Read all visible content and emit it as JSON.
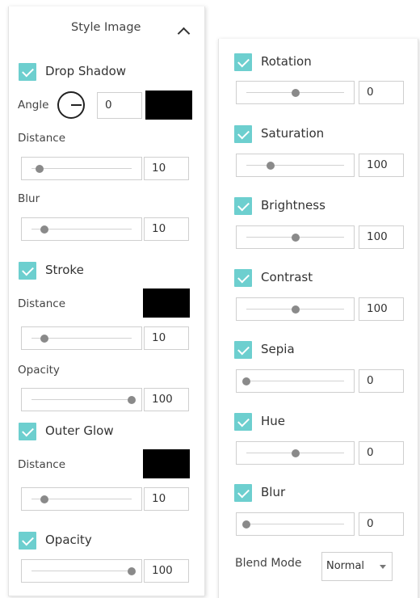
{
  "header": {
    "title": "Style Image"
  },
  "left": {
    "drop_shadow": {
      "label": "Drop Shadow",
      "checked": true,
      "angle_label": "Angle",
      "angle_value": "0",
      "color": "#000000",
      "distance_label": "Distance",
      "distance_value": "10",
      "distance_fraction": 0.08,
      "blur_label": "Blur",
      "blur_value": "10",
      "blur_fraction": 0.13
    },
    "stroke": {
      "label": "Stroke",
      "checked": true,
      "color": "#000000",
      "distance_label": "Distance",
      "distance_value": "10",
      "distance_fraction": 0.13,
      "opacity_label": "Opacity",
      "opacity_value": "100",
      "opacity_fraction": 1.0
    },
    "outer_glow": {
      "label": "Outer Glow",
      "checked": true,
      "color": "#000000",
      "distance_label": "Distance",
      "distance_value": "10",
      "distance_fraction": 0.13
    },
    "opacity": {
      "label": "Opacity",
      "checked": true,
      "value": "100",
      "fraction": 1.0
    }
  },
  "right": {
    "rotation": {
      "label": "Rotation",
      "checked": true,
      "value": "0",
      "fraction": 0.5
    },
    "saturation": {
      "label": "Saturation",
      "checked": true,
      "value": "100",
      "fraction": 0.25
    },
    "brightness": {
      "label": "Brightness",
      "checked": true,
      "value": "100",
      "fraction": 0.5
    },
    "contrast": {
      "label": "Contrast",
      "checked": true,
      "value": "100",
      "fraction": 0.5
    },
    "sepia": {
      "label": "Sepia",
      "checked": true,
      "value": "0",
      "fraction": 0.0
    },
    "hue": {
      "label": "Hue",
      "checked": true,
      "value": "0",
      "fraction": 0.5
    },
    "blur": {
      "label": "Blur",
      "checked": true,
      "value": "0",
      "fraction": 0.0
    },
    "blend_mode": {
      "label": "Blend Mode",
      "value": "Normal"
    }
  },
  "colors": {
    "accent": "#6dcfcf",
    "swatch": "#000000",
    "thumb": "#8a8a8a"
  }
}
